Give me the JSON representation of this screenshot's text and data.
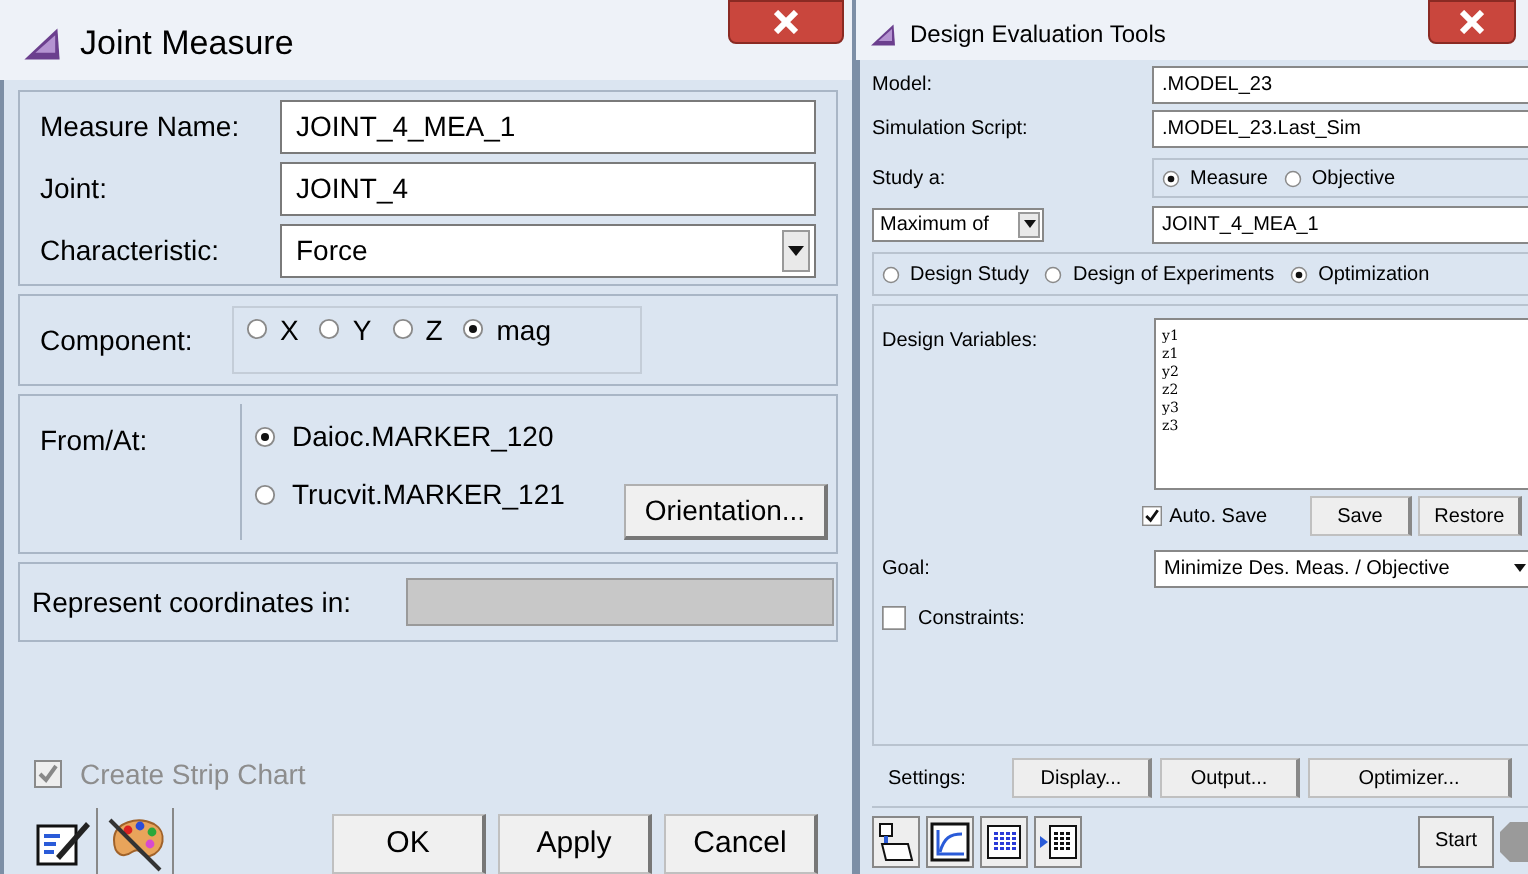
{
  "joint_measure": {
    "title": "Joint Measure",
    "fields": [
      {
        "label": "Measure Name:",
        "value": "JOINT_4_MEA_1",
        "kind": "text"
      },
      {
        "label": "Joint:",
        "value": "JOINT_4",
        "kind": "text"
      },
      {
        "label": "Characteristic:",
        "value": "Force",
        "kind": "dropdown"
      }
    ],
    "component": {
      "label": "Component:",
      "options": [
        {
          "label": "X",
          "selected": false
        },
        {
          "label": "Y",
          "selected": false
        },
        {
          "label": "Z",
          "selected": false
        },
        {
          "label": "mag",
          "selected": true
        }
      ]
    },
    "from_at": {
      "label": "From/At:",
      "options": [
        {
          "label": "Daioc.MARKER_120",
          "selected": true
        },
        {
          "label": "Trucvit.MARKER_121",
          "selected": false
        }
      ],
      "button": "Orientation..."
    },
    "represent": {
      "label": "Represent coordinates in:"
    },
    "strip_chart": {
      "label": "Create Strip Chart",
      "checked": true,
      "disabled": true
    },
    "buttons": [
      "OK",
      "Apply",
      "Cancel"
    ]
  },
  "design_evaluation": {
    "title": "Design Evaluation Tools",
    "fields": [
      {
        "label": "Model:",
        "value": ".MODEL_23"
      },
      {
        "label": "Simulation Script:",
        "value": ".MODEL_23.Last_Sim"
      }
    ],
    "study": {
      "label": "Study a:",
      "options": [
        {
          "label": "Measure",
          "selected": true
        },
        {
          "label": "Objective",
          "selected": false
        }
      ]
    },
    "study_mode": "Maximum of",
    "measure": "JOINT_4_MEA_1",
    "study_types": [
      {
        "label": "Design Study",
        "selected": false
      },
      {
        "label": "Design of Experiments",
        "selected": false
      },
      {
        "label": "Optimization",
        "selected": true
      }
    ],
    "design_variables": {
      "label": "Design Variables:",
      "items": [
        "y1",
        "z1",
        "y2",
        "z2",
        "y3",
        "z3"
      ]
    },
    "auto_save": {
      "label": "Auto. Save",
      "checked": true
    },
    "save_buttons": [
      "Save",
      "Restore"
    ],
    "goal": {
      "label": "Goal:",
      "value": "Minimize Des. Meas. / Objective"
    },
    "constraints": {
      "label": "Constraints:",
      "checked": false
    },
    "settings": {
      "label": "Settings:",
      "buttons": [
        "Display...",
        "Output...",
        "Optimizer..."
      ]
    },
    "start_button": "Start"
  }
}
